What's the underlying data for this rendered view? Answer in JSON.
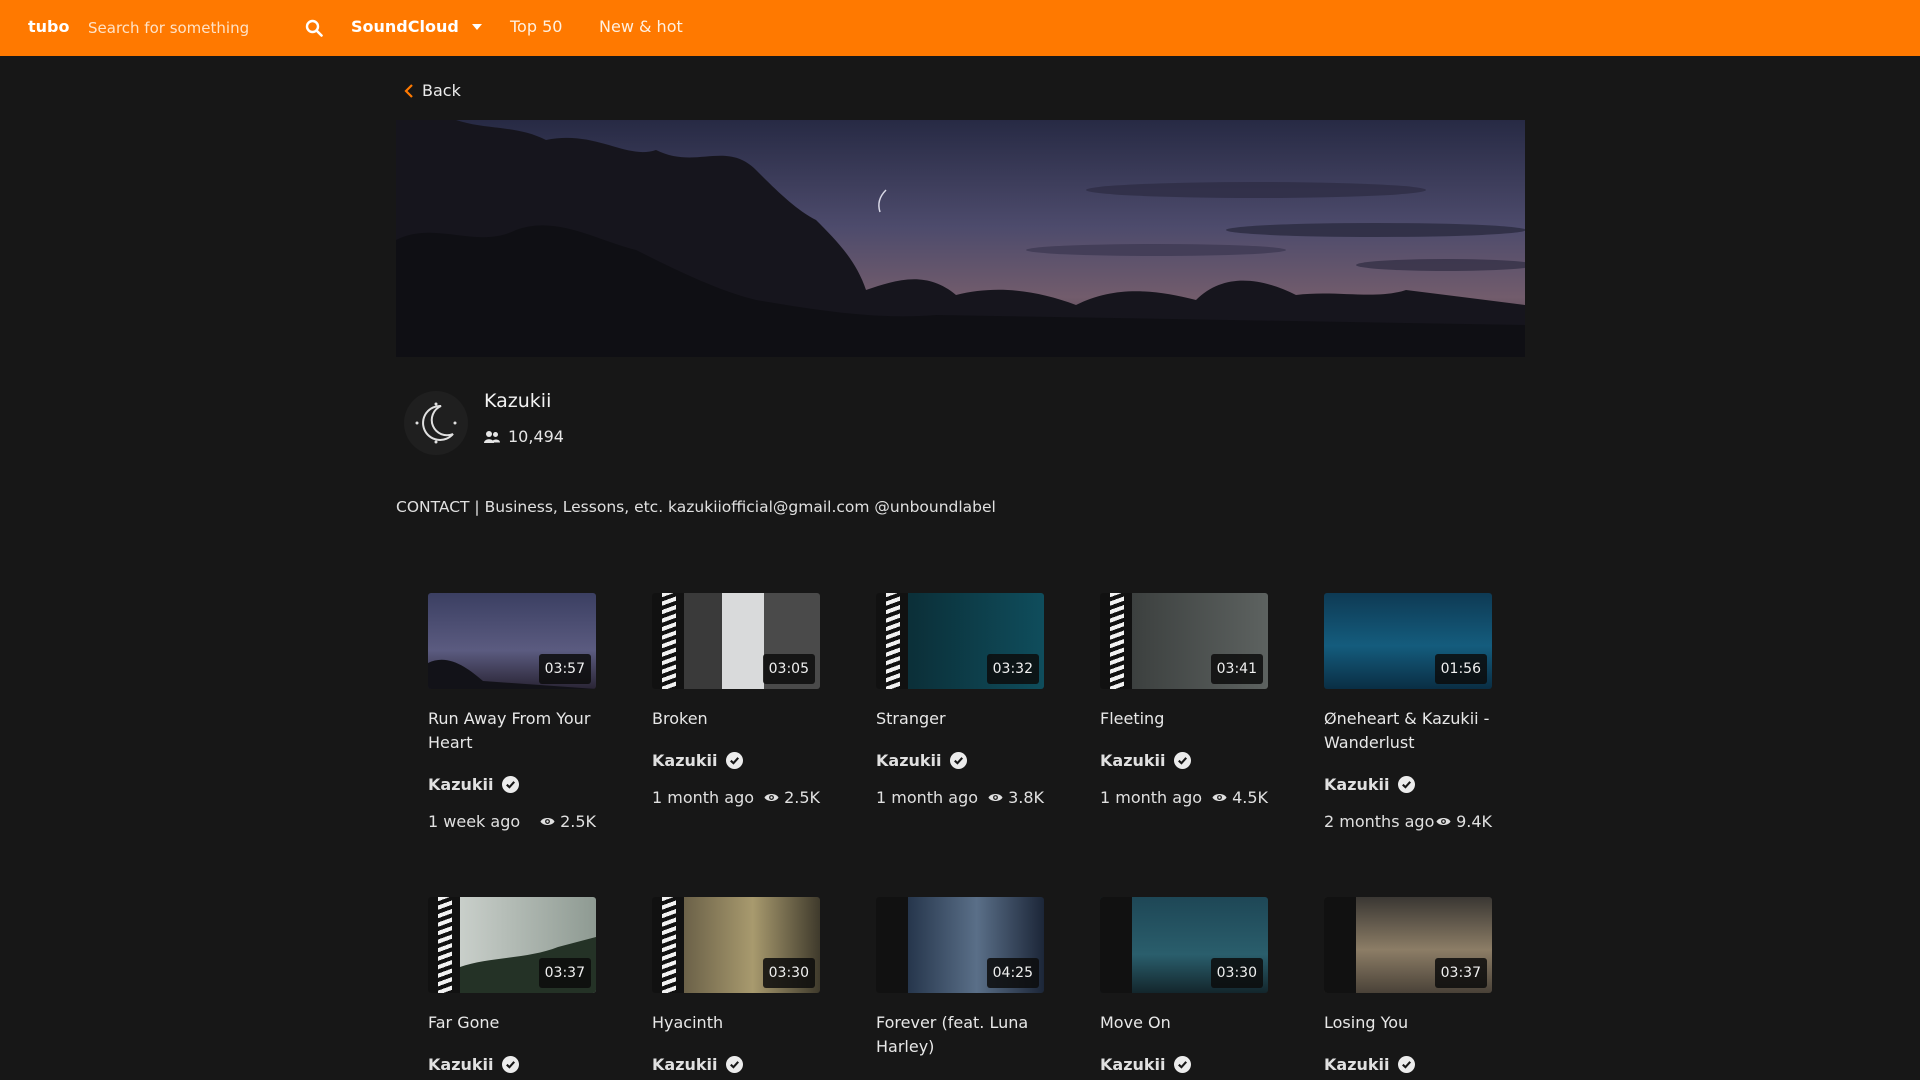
{
  "app": {
    "logo": "tubo"
  },
  "search": {
    "placeholder": "Search for something"
  },
  "nav": {
    "service": "SoundCloud",
    "links": [
      "Top 50",
      "New & hot"
    ]
  },
  "back_label": "Back",
  "channel": {
    "name": "Kazukii",
    "followers": "10,494",
    "description": "CONTACT | Business, Lessons, etc. kazukiiofficial@gmail.com @unboundlabel"
  },
  "colors": {
    "accent": "#ff7900",
    "background": "#171717"
  },
  "tracks": [
    {
      "title": "Run Away From Your Heart",
      "duration": "03:57",
      "artist": "Kazukii",
      "age": "1 week ago",
      "views": "2.5K"
    },
    {
      "title": "Broken",
      "duration": "03:05",
      "artist": "Kazukii",
      "age": "1 month ago",
      "views": "2.5K"
    },
    {
      "title": "Stranger",
      "duration": "03:32",
      "artist": "Kazukii",
      "age": "1 month ago",
      "views": "3.8K"
    },
    {
      "title": "Fleeting",
      "duration": "03:41",
      "artist": "Kazukii",
      "age": "1 month ago",
      "views": "4.5K"
    },
    {
      "title": "Øneheart & Kazukii - Wanderlust",
      "duration": "01:56",
      "artist": "Kazukii",
      "age": "2 months ago",
      "views": "9.4K"
    },
    {
      "title": "Far Gone",
      "duration": "03:37",
      "artist": "Kazukii",
      "age": "",
      "views": ""
    },
    {
      "title": "Hyacinth",
      "duration": "03:30",
      "artist": "Kazukii",
      "age": "",
      "views": ""
    },
    {
      "title": "Forever (feat. Luna Harley)",
      "duration": "04:25",
      "artist": "",
      "age": "",
      "views": ""
    },
    {
      "title": "Move On",
      "duration": "03:30",
      "artist": "Kazukii",
      "age": "",
      "views": ""
    },
    {
      "title": "Losing You",
      "duration": "03:37",
      "artist": "Kazukii",
      "age": "",
      "views": ""
    }
  ]
}
